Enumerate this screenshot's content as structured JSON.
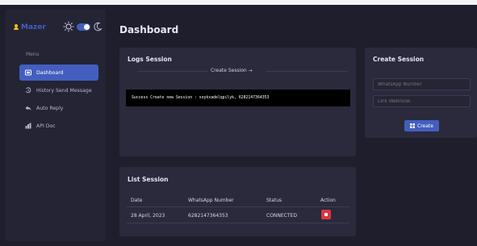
{
  "brand": {
    "name": "Mazer"
  },
  "sidebar": {
    "menu_title": "Menu",
    "items": [
      {
        "label": "Dashboard",
        "icon": "grid-icon",
        "active": true
      },
      {
        "label": "History Send Message",
        "icon": "history-icon",
        "active": false
      },
      {
        "label": "Auto Reply",
        "icon": "reply-icon",
        "active": false
      },
      {
        "label": "API Doc",
        "icon": "api-doc-icon",
        "active": false
      }
    ]
  },
  "header": {
    "title": "Dashboard"
  },
  "logs": {
    "title": "Logs Session",
    "create_link": "Create Session →",
    "console_text": "Success Create new Session : soykxadelqpilyk, 6282147364353"
  },
  "list_session": {
    "title": "List Session",
    "columns": [
      "Date",
      "WhatsApp Number",
      "Status",
      "Action"
    ],
    "rows": [
      {
        "date": "28 April, 2023",
        "number": "6282147364353",
        "status": "CONNECTED"
      }
    ]
  },
  "create_session": {
    "title": "Create Session",
    "number_placeholder": "WhatsApp Number",
    "webhook_placeholder": "Link Webhook",
    "button_label": "Create"
  },
  "colors": {
    "background": "#1e1e2d",
    "card": "#2a2a3c",
    "accent": "#435ebe",
    "danger": "#dc3545"
  }
}
